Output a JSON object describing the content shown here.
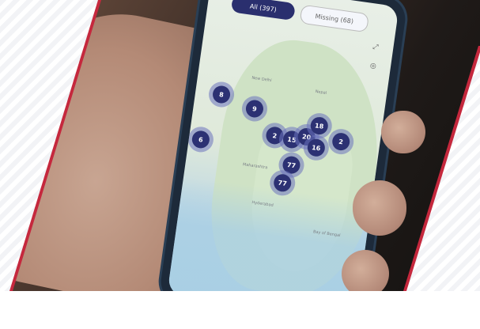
{
  "filters": {
    "all": "All (397)",
    "missing": "Missing (68)"
  },
  "map_labels": {
    "delhi": "New Delhi",
    "nepal": "Nepal",
    "maharashtra": "Maharashtra",
    "hyderabad": "Hyderabad",
    "sea": "Bay of Bengal"
  },
  "clusters": [
    {
      "count": "8"
    },
    {
      "count": "9"
    },
    {
      "count": "6"
    },
    {
      "count": "2"
    },
    {
      "count": "15"
    },
    {
      "count": "20"
    },
    {
      "count": "16"
    },
    {
      "count": "18"
    },
    {
      "count": "2"
    },
    {
      "count": "77"
    },
    {
      "count": "77"
    }
  ],
  "icons": {
    "fullscreen": "expand-icon",
    "locate": "locate-icon"
  },
  "colors": {
    "accent_red": "#c5283d",
    "cluster": "#2c3173"
  }
}
